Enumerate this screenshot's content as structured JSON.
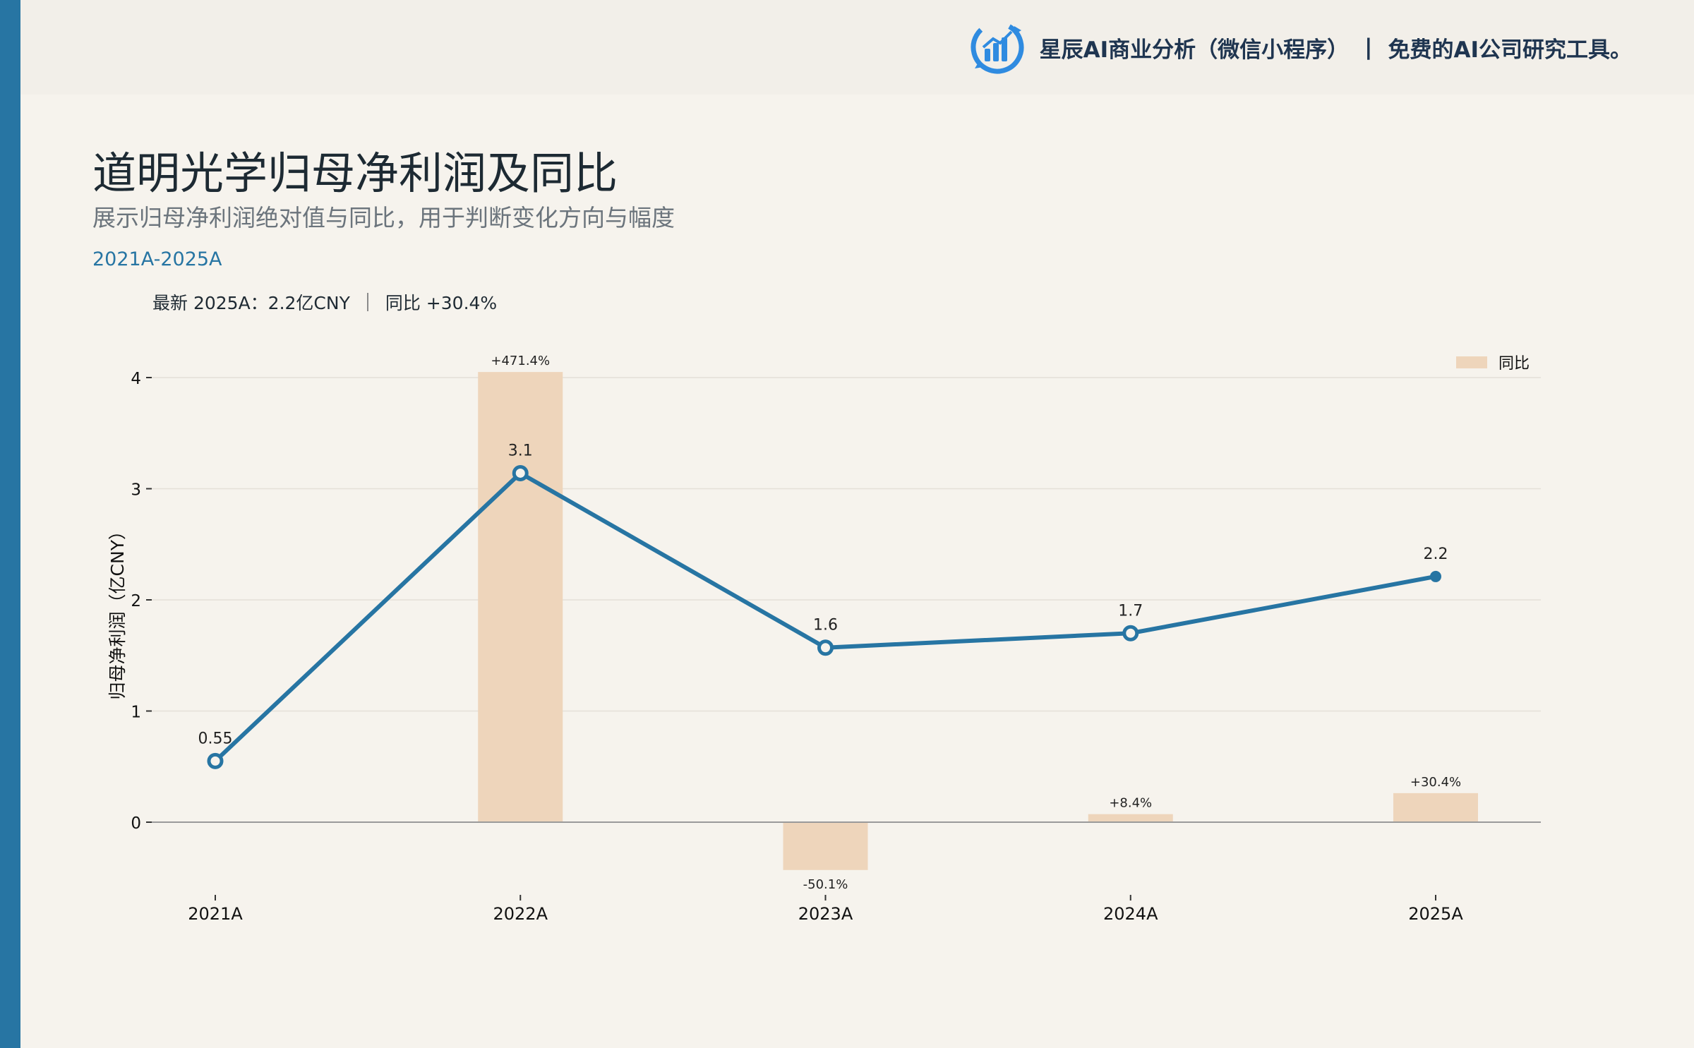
{
  "header": {
    "brand_name": "星辰AI商业分析（微信小程序）",
    "separator": "|",
    "tagline": "免费的AI公司研究工具。",
    "logo_icon": "bar-chart-refresh-logo",
    "brand_color": "#2775a3"
  },
  "page": {
    "title": "道明光学归母净利润及同比",
    "subtitle": "展示归母净利润绝对值与同比，用于判断变化方向与幅度",
    "range": "2021A-2025A",
    "latest_label": "最新 2025A：2.2亿CNY",
    "latest_yoy": "同比 +30.4%"
  },
  "chart_data": {
    "type": "bar",
    "categories": [
      "2021A",
      "2022A",
      "2023A",
      "2024A",
      "2025A"
    ],
    "ylabel": "归母净利润（亿CNY）",
    "ylim": [
      -0.5,
      4.3
    ],
    "yticks": [
      0,
      1,
      2,
      3,
      4
    ],
    "grid": true,
    "legend_position": "top-right",
    "series": [
      {
        "name": "同比",
        "kind": "bar",
        "color": "#eed5bb",
        "values": [
          null,
          471.4,
          -50.1,
          8.4,
          30.4
        ],
        "labels": [
          "",
          "+471.4%",
          "-50.1%",
          "+8.4%",
          "+30.4%"
        ]
      },
      {
        "kind": "line",
        "color": "#2775a3",
        "values": [
          0.55,
          3.14,
          1.57,
          1.7,
          2.21
        ],
        "labels": [
          "0.55",
          "3.1",
          "1.6",
          "1.7",
          "2.2"
        ]
      }
    ]
  }
}
